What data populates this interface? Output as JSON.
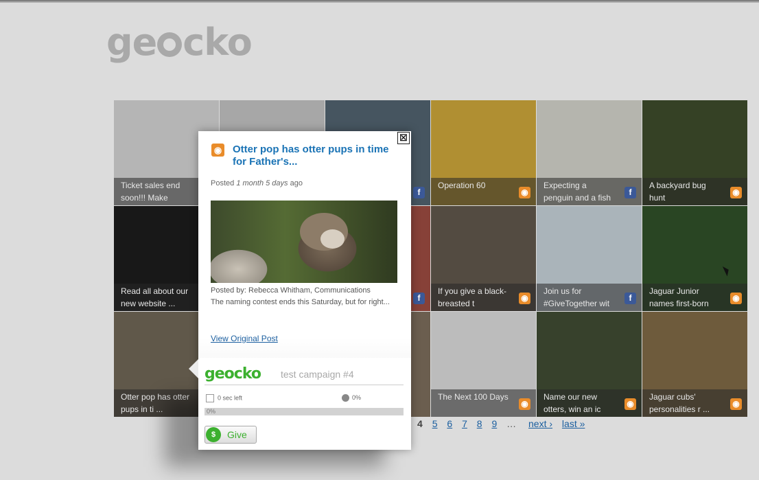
{
  "logo": {
    "text_left": "ge",
    "text_right": "cko"
  },
  "tiles": [
    {
      "caption": "Ticket sales end soon!!! Make",
      "source": "",
      "bg": "#cfcfcf"
    },
    {
      "caption": "",
      "source": "",
      "bg": "#bfbfbf"
    },
    {
      "caption": "",
      "source": "fb",
      "bg": "#50616e"
    },
    {
      "caption": "Operation 60",
      "source": "rss",
      "bg": "#c9a33a"
    },
    {
      "caption": "Expecting a penguin and a fish",
      "source": "fb",
      "bg": "#cfcfc6"
    },
    {
      "caption": "A backyard bug hunt",
      "source": "rss",
      "bg": "#3d4b2b"
    },
    {
      "caption": "Read all about our new website ...",
      "source": "",
      "bg": "#1c1c1c"
    },
    {
      "caption": "",
      "source": "",
      "bg": "#c5c5c5"
    },
    {
      "caption": "",
      "source": "fb",
      "bg": "#9a4a40"
    },
    {
      "caption": "If you give a black-breasted t",
      "source": "rss",
      "bg": "#5f564a"
    },
    {
      "caption": "Join us for #GiveTogether wit",
      "source": "fb",
      "bg": "#c2cdd4"
    },
    {
      "caption": "Jaguar Junior names first-born",
      "source": "rss",
      "bg": "#2f4f28"
    },
    {
      "caption": "Otter pop has otter pups in ti ...",
      "source": "",
      "bg": "#6e6555"
    },
    {
      "caption": "",
      "source": "",
      "bg": "#cccccc"
    },
    {
      "caption": "",
      "source": "",
      "bg": "#7a6c5a"
    },
    {
      "caption": "The Next 100 Days",
      "source": "rss",
      "bg": "#d7d7d7"
    },
    {
      "caption": "Name our new otters, win an ic",
      "source": "rss",
      "bg": "#3f4a33"
    },
    {
      "caption": "Jaguar cubs' personalities r ...",
      "source": "rss",
      "bg": "#7e6845"
    }
  ],
  "tile_icons": {
    "rss": "rss-icon",
    "fb": "facebook-icon"
  },
  "pager": {
    "current": "4",
    "pages": [
      "5",
      "6",
      "7",
      "8",
      "9"
    ],
    "dots": "…",
    "next": "next ›",
    "last": "last »"
  },
  "popup": {
    "close": "☒",
    "title": "Otter pop has otter pups in time for Father's...",
    "posted_prefix": "Posted",
    "posted_time": "1 month 5 days",
    "posted_suffix": "ago",
    "byline": "Posted by: Rebecca Whitham, Communications",
    "excerpt": "The naming contest ends this Saturday, but for right...",
    "view_link": "View Original Post"
  },
  "campaign": {
    "logo": "geocko",
    "name": "test campaign #4",
    "time_left": "0 sec left",
    "percent": "0%",
    "bar_label": "0%",
    "progress": 0,
    "give_label": "Give"
  },
  "colors": {
    "brand_green": "#3cb02f",
    "link_blue": "#1a73b5",
    "rss_orange": "#e98c2a",
    "fb_blue": "#3b5998"
  }
}
